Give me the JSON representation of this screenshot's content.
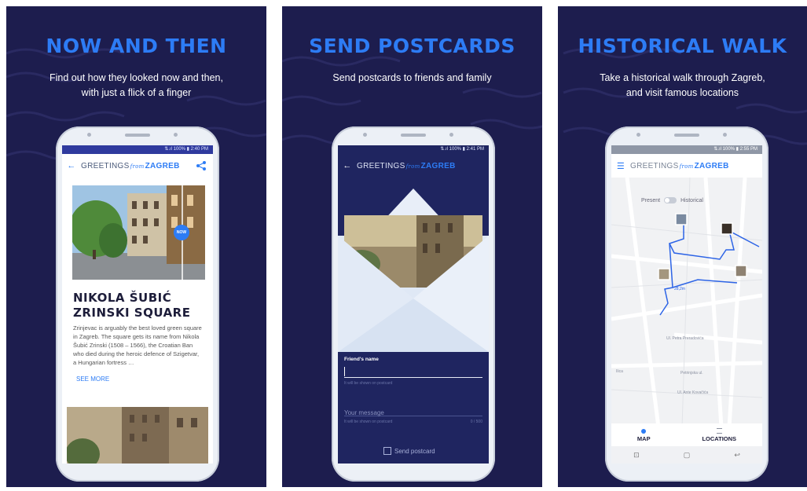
{
  "panels": [
    {
      "title": "NOW AND THEN",
      "subtitle_line1": "Find out how they looked now and then,",
      "subtitle_line2": "with just a flick of a finger",
      "status": "⇅.ıl 100% ▮ 2:40 PM",
      "brand_left": "GREETINGS",
      "brand_script": "from",
      "brand_right": "ZAGREB",
      "badge": "NOW",
      "place_line1": "NIKOLA ŠUBIĆ",
      "place_line2": "ZRINSKI SQUARE",
      "description": "Zrinjevac is arguably the best loved green square in Zagreb. The square gets its name from Nikola Šubić Zrinski (1508 – 1566), the Croatian Ban who died during the heroic defence of Szigetvar, a Hungarian fortress …",
      "see_more": "SEE MORE"
    },
    {
      "title": "SEND POSTCARDS",
      "subtitle_line1": "Send postcards to friends and family",
      "status": "⇅.ıl 100% ▮ 2:41 PM",
      "brand_left": "GREETINGS",
      "brand_script": "from",
      "brand_right": "ZAGREB",
      "friend_label": "Friend's name",
      "friend_hint": "It will be shown on postcard",
      "message_placeholder": "Your message",
      "message_hint": "It will be shown on postcard",
      "message_count": "0 / 500",
      "send_label": "Send postcard"
    },
    {
      "title": "HISTORICAL WALK",
      "subtitle_line1": "Take a historical walk through Zagreb,",
      "subtitle_line2": "and visit famous locations",
      "status": "⇅.ıl 100% ▮ 2:55 PM",
      "brand_left": "GREETINGS",
      "brand_script": "from",
      "brand_right": "ZAGREB",
      "toggle_left": "Present",
      "toggle_right": "Historical",
      "distance": "28,2m",
      "street1": "Ul. Petra Preradovića",
      "street2": "Petrinjska ul.",
      "street3": "Ul. Ante Kovačića",
      "street4": "Ilica",
      "tab_map": "MAP",
      "tab_locations": "LOCATIONS"
    }
  ],
  "colors": {
    "panel_bg": "#1d1d4e",
    "accent": "#2d7cf5"
  }
}
